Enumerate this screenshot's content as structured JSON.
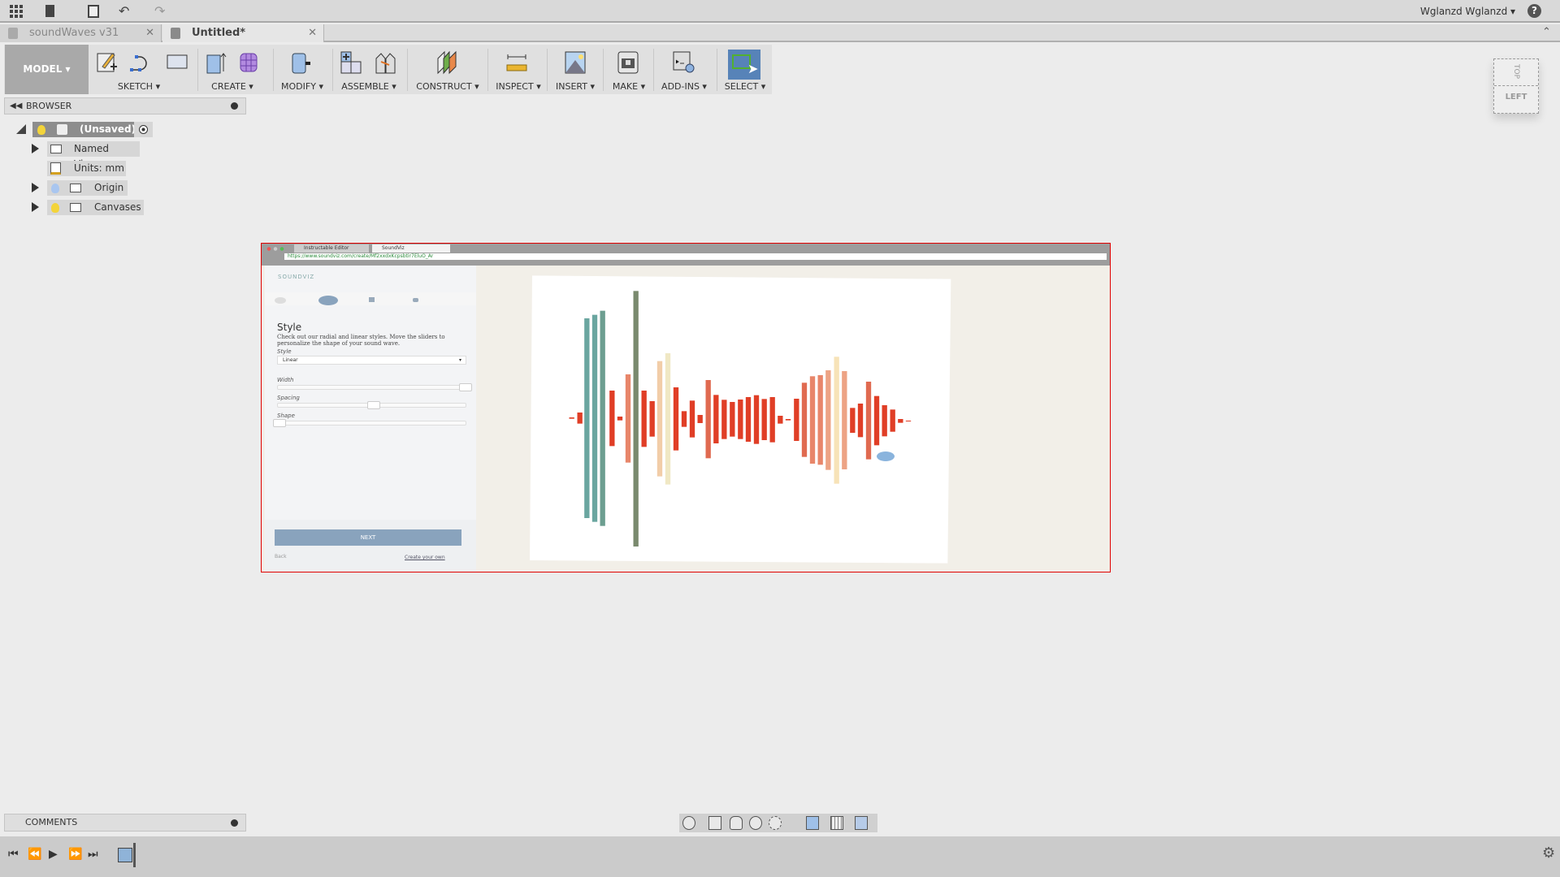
{
  "app": {
    "user_menu": "Wglanzd Wglanzd",
    "help_icon": "question-icon"
  },
  "document_tabs": [
    {
      "label": "soundWaves v31",
      "active": false
    },
    {
      "label": "Untitled*",
      "active": true
    }
  ],
  "toolbar": {
    "workspace": "MODEL",
    "groups": [
      "SKETCH",
      "CREATE",
      "MODIFY",
      "ASSEMBLE",
      "CONSTRUCT",
      "INSPECT",
      "INSERT",
      "MAKE",
      "ADD-INS",
      "SELECT"
    ],
    "active_group": "SELECT"
  },
  "browser": {
    "title": "BROWSER",
    "root": "(Unsaved)",
    "items": [
      {
        "label": "Named Views",
        "expandable": true
      },
      {
        "label": "Units: mm",
        "expandable": false
      },
      {
        "label": "Origin",
        "expandable": true
      },
      {
        "label": "Canvases",
        "expandable": true
      }
    ]
  },
  "viewcube": {
    "top": "TOP",
    "front": "LEFT"
  },
  "comments": {
    "title": "COMMENTS"
  },
  "canvas_image": {
    "browser_tabs": [
      "Instructable Editor",
      "SoundViz"
    ],
    "url": "https://www.soundviz.com/create/Mf2xxdxKcpsbtir7EluO_Ar",
    "logo": "SOUNDVIZ",
    "heading": "Style",
    "description": "Check out our radial and linear styles. Move the sliders to personalize the shape of your sound wave.",
    "style_label": "Style",
    "style_value": "Linear",
    "sliders": [
      {
        "label": "Width",
        "value": 1.0
      },
      {
        "label": "Spacing",
        "value": 0.5
      },
      {
        "label": "Shape",
        "value": 0.0
      }
    ],
    "next_button": "NEXT",
    "back_link": "Back",
    "create_link": "Create your own",
    "colors": {
      "accent": "#89a3bd",
      "wave_red": "#e03e26",
      "wave_teal": "#6aa6a0",
      "wave_olive": "#7a8a6e",
      "frame": "#e00000"
    }
  }
}
